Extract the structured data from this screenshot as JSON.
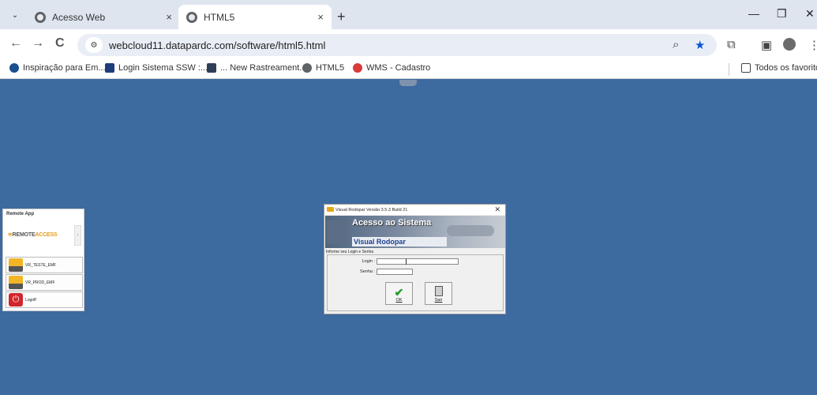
{
  "browser": {
    "tabs": [
      {
        "title": "Acesso Web",
        "active": false
      },
      {
        "title": "HTML5",
        "active": true
      }
    ],
    "url": "webcloud11.datapardc.com/software/html5.html",
    "bookmarks": [
      "Inspiração para Em...",
      "Login Sistema SSW :...",
      "... New Rastreament...",
      "HTML5",
      "WMS - Cadastro"
    ],
    "favorites_label": "Todos os favoritos",
    "icons": {
      "new_tab": "+",
      "close": "×",
      "minimize": "—",
      "restore": "❐",
      "window_close": "✕",
      "back": "←",
      "forward": "→",
      "reload": "C",
      "zoom": "🔍",
      "star": "★",
      "menu": "⋮"
    }
  },
  "remote_app": {
    "title": "Remote App",
    "logo_brand": "REMOTE",
    "logo_accent": "ACCESS",
    "logo_mark": "≋",
    "collapse": "‹",
    "apps": [
      {
        "label": "VR_TESTE_EMF"
      },
      {
        "label": "VR_PROD_EMF"
      },
      {
        "label": "Logoff"
      }
    ]
  },
  "login_dialog": {
    "window_title": "Visual Rodopar Versão 3.5.3 Build 21",
    "banner_title": "Acesso ao Sistema",
    "banner_subtitle": "Visual Rodopar",
    "section_label": "Informe seu Login e Senha",
    "login_label": "Login :",
    "password_label": "Senha :",
    "login_value": "",
    "password_value": "",
    "ok_label": "OK",
    "exit_label": "Sair"
  },
  "colors": {
    "desktop_bg": "#3d6a9f",
    "tabbar_bg": "#dfe5ef",
    "accent": "#0b57d0"
  }
}
